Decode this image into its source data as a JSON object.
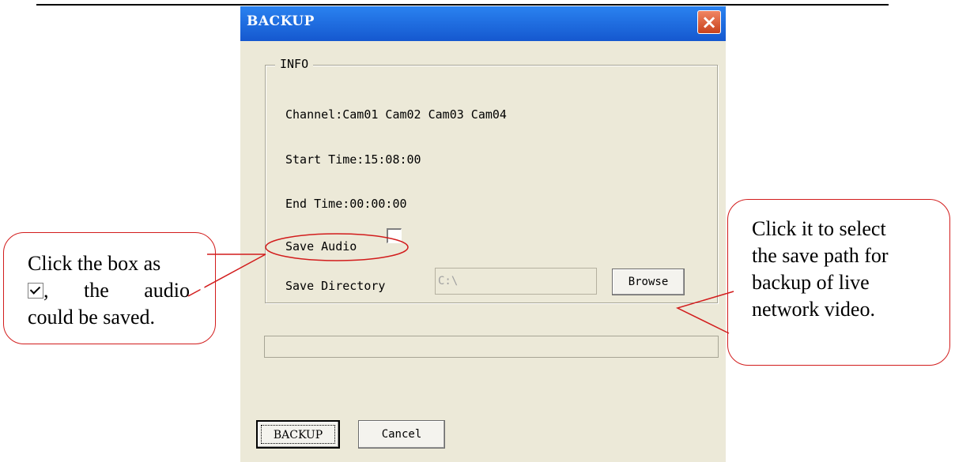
{
  "dialog": {
    "title": "BACKUP",
    "close_icon": "close-icon",
    "info_legend": "INFO",
    "channel_text": "Channel:Cam01 Cam02 Cam03 Cam04",
    "start_time_text": "Start Time:15:08:00",
    "end_time_text": "End Time:00:00:00",
    "save_audio_label": "Save Audio",
    "save_audio_checked": false,
    "save_directory_label": "Save Directory",
    "save_directory_value": "C:\\",
    "browse_label": "Browse",
    "backup_label": "BACKUP",
    "cancel_label": "Cancel"
  },
  "annotations": {
    "left": {
      "line1": "Click the box as",
      "line2_sep": ",",
      "line2_a": "the",
      "line2_b": "audio",
      "line3": "could be saved.",
      "check_icon": "checked-checkbox-icon"
    },
    "right": {
      "lines": [
        "Click it to select",
        "the save path for",
        "backup of live",
        "network video."
      ]
    },
    "accent": "#d21c1c"
  }
}
